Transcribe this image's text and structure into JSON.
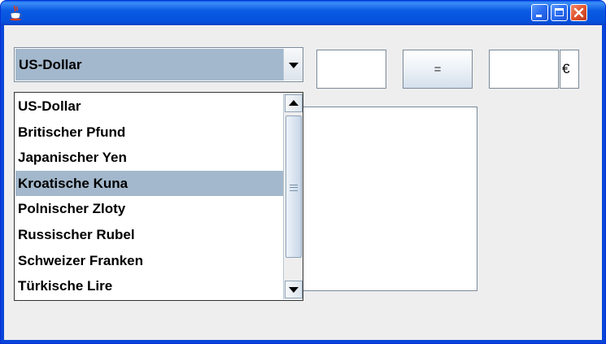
{
  "window": {
    "icon": "java-cup-icon",
    "controls": [
      "minimize-icon",
      "maximize-icon",
      "close-icon"
    ]
  },
  "currency_combo": {
    "selected": "US-Dollar",
    "arrow_icon": "chevron-down-icon",
    "options": [
      "US-Dollar",
      "Britischer Pfund",
      "Japanischer Yen",
      "Kroatische Kuna",
      "Polnischer Zloty",
      "Russischer Rubel",
      "Schweizer Franken",
      "Türkische Lire"
    ],
    "highlighted_option": "Kroatische Kuna"
  },
  "amount_input": {
    "value": ""
  },
  "equals_button": {
    "label": "="
  },
  "result_input": {
    "value": ""
  },
  "euro_label": "€",
  "colors": {
    "selection": "#a3b8cc",
    "titlebar": "#0a5fe8",
    "panel": "#eeeeee"
  }
}
